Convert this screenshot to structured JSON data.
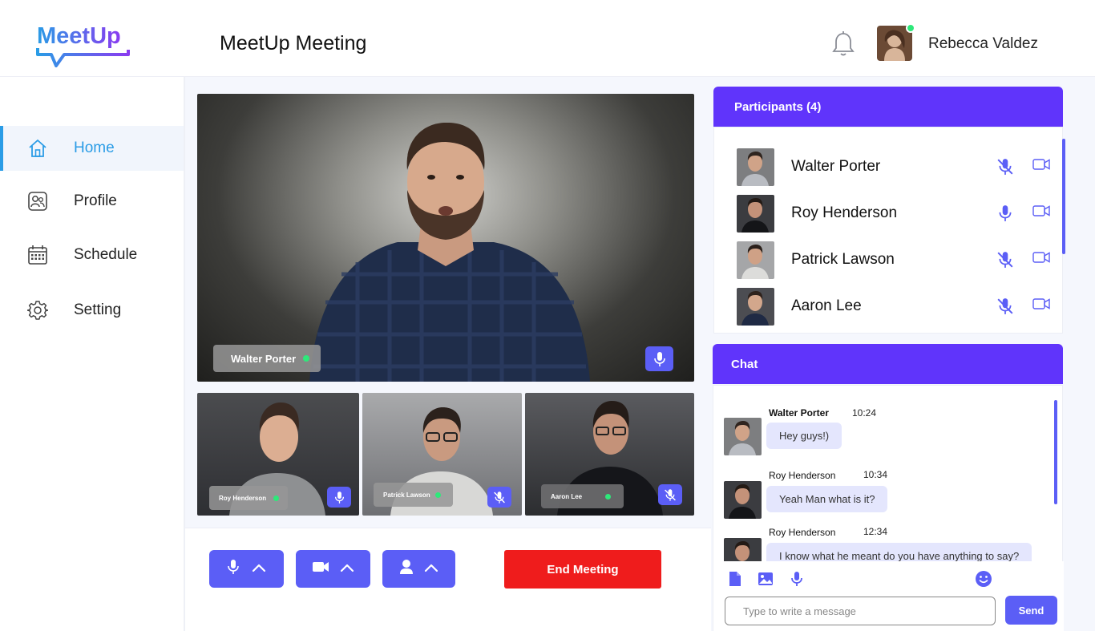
{
  "app": {
    "logo_text": "MeetUp",
    "page_title": "MeetUp Meeting"
  },
  "user": {
    "name": "Rebecca Valdez",
    "online": true
  },
  "sidebar": {
    "items": [
      {
        "label": "Home",
        "icon": "home-icon",
        "active": true
      },
      {
        "label": "Profile",
        "icon": "profile-icon",
        "active": false
      },
      {
        "label": "Schedule",
        "icon": "calendar-icon",
        "active": false
      },
      {
        "label": "Setting",
        "icon": "gear-icon",
        "active": false
      }
    ]
  },
  "stage": {
    "main": {
      "name": "Walter Porter",
      "mic": "on"
    },
    "thumbnails": [
      {
        "name": "Roy Henderson",
        "mic": "on"
      },
      {
        "name": "Patrick Lawson",
        "mic": "muted"
      },
      {
        "name": "Aaron Lee",
        "mic": "muted"
      }
    ]
  },
  "controls": {
    "end_label": "End Meeting"
  },
  "participants": {
    "title": "Participants (4)",
    "list": [
      {
        "name": "Walter Porter",
        "mic": "muted",
        "camera": "on"
      },
      {
        "name": "Roy Henderson",
        "mic": "on",
        "camera": "on"
      },
      {
        "name": "Patrick Lawson",
        "mic": "muted",
        "camera": "on"
      },
      {
        "name": "Aaron Lee",
        "mic": "muted",
        "camera": "on"
      }
    ]
  },
  "chat": {
    "title": "Chat",
    "messages": [
      {
        "sender": "Walter Porter",
        "time": "10:24",
        "text": "Hey guys!)"
      },
      {
        "sender": "Roy Henderson",
        "time": "10:34",
        "text": "Yeah Man what is it?"
      },
      {
        "sender": "Roy Henderson",
        "time": "12:34",
        "text": "I know what he meant do you have anything to say?"
      }
    ],
    "input_placeholder": "Type to write a message",
    "send_label": "Send"
  },
  "colors": {
    "accent": "#5b5ef6",
    "panel_header": "#6034fb",
    "end_meeting": "#ef1c1c",
    "active_nav": "#2a9ce6",
    "online": "#2ee87a"
  }
}
